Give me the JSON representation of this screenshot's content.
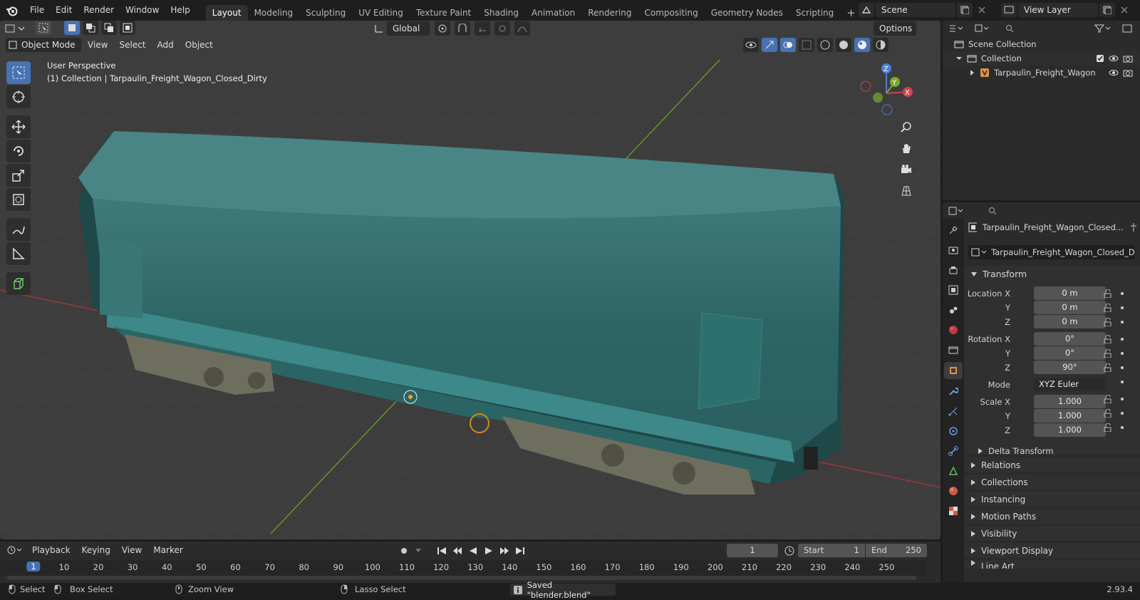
{
  "menus": [
    "File",
    "Edit",
    "Render",
    "Window",
    "Help"
  ],
  "workspaces": [
    "Layout",
    "Modeling",
    "Sculpting",
    "UV Editing",
    "Texture Paint",
    "Shading",
    "Animation",
    "Rendering",
    "Compositing",
    "Geometry Nodes",
    "Scripting"
  ],
  "active_workspace": "Layout",
  "scene": "Scene",
  "view_layer": "View Layer",
  "viewport": {
    "transform_orientation": "Global",
    "options": "Options",
    "mode": "Object Mode",
    "header_menus": [
      "View",
      "Select",
      "Add",
      "Object"
    ],
    "info_line1": "User Perspective",
    "info_line2": "(1) Collection | Tarpaulin_Freight_Wagon_Closed_Dirty",
    "gizmo": {
      "z": "Z",
      "y": "Y",
      "x": "X"
    }
  },
  "outliner": {
    "scene_collection": "Scene Collection",
    "collection": "Collection",
    "object": "Tarpaulin_Freight_Wagon"
  },
  "properties": {
    "object_name": "Tarpaulin_Freight_Wagon_Closed...",
    "data_name": "Tarpaulin_Freight_Wagon_Closed_Dir...",
    "transform_header": "Transform",
    "location": {
      "label_x": "Location X",
      "label_y": "Y",
      "label_z": "Z",
      "x": "0 m",
      "y": "0 m",
      "z": "0 m"
    },
    "rotation": {
      "label_x": "Rotation X",
      "label_y": "Y",
      "label_z": "Z",
      "x": "0°",
      "y": "0°",
      "z": "90°"
    },
    "mode_label": "Mode",
    "mode_value": "XYZ Euler",
    "scale": {
      "label_x": "Scale X",
      "label_y": "Y",
      "label_z": "Z",
      "x": "1.000",
      "y": "1.000",
      "z": "1.000"
    },
    "delta_transform": "Delta Transform",
    "panels": [
      "Relations",
      "Collections",
      "Instancing",
      "Motion Paths",
      "Visibility",
      "Viewport Display",
      "Line Art"
    ]
  },
  "timeline": {
    "menus": [
      "Playback",
      "Keying",
      "View",
      "Marker"
    ],
    "current_frame": "1",
    "start_label": "Start",
    "start": "1",
    "end_label": "End",
    "end": "250",
    "frame_marks": [
      "1",
      "10",
      "20",
      "30",
      "40",
      "50",
      "60",
      "70",
      "80",
      "90",
      "100",
      "110",
      "120",
      "130",
      "140",
      "150",
      "160",
      "170",
      "180",
      "190",
      "200",
      "210",
      "220",
      "230",
      "240",
      "250"
    ]
  },
  "statusbar": {
    "select": "Select",
    "box_select": "Box Select",
    "zoom_view": "Zoom View",
    "lasso_select": "Lasso Select",
    "message": "Saved \"blender.blend\"",
    "version": "2.93.4"
  },
  "colors": {
    "accent": "#4772b3",
    "panel": "#2b2b2b",
    "viewport": "#3d3d3d",
    "tarp": "#2f6b6b",
    "active_frame": "#4772b3"
  }
}
